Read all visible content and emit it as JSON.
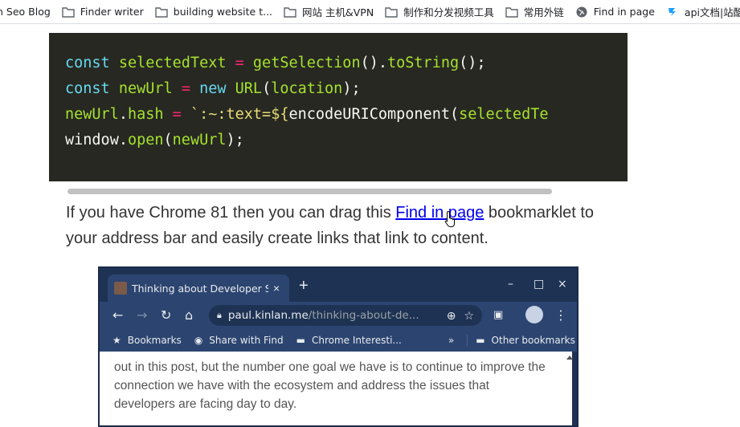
{
  "bookmarks_bar": {
    "items": [
      {
        "label": "n Seo Blog",
        "icon": "none"
      },
      {
        "label": "Finder writer",
        "icon": "folder-icon"
      },
      {
        "label": "building website t...",
        "icon": "folder-icon"
      },
      {
        "label": "网站 主机&VPN",
        "icon": "folder-icon"
      },
      {
        "label": "制作和分发视频工具",
        "icon": "folder-icon"
      },
      {
        "label": "常用外链",
        "icon": "folder-icon"
      },
      {
        "label": "Find in page",
        "icon": "globe-icon"
      },
      {
        "label": "api文档|站酷海洛",
        "icon": "brand-icon"
      }
    ]
  },
  "code_block": {
    "line1": {
      "kw": "const",
      "name": "selectedText",
      "op": "=",
      "fn": "getSelection",
      "p1": "().",
      "fn2": "toString",
      "p2": "();"
    },
    "line2": {
      "kw": "const",
      "name": "newUrl",
      "op": "=",
      "kw2": "new",
      "fn": "URL",
      "p1": "(",
      "arg": "location",
      "p2": ");"
    },
    "line3": {
      "obj": "newUrl",
      "dot": ".",
      "prop": "hash",
      "op": "=",
      "tpl": "`:~:text=${",
      "fn": "encodeURIComponent",
      "p1": "(",
      "arg": "selectedTe"
    },
    "line4": {
      "obj": "window",
      "dot": ".",
      "fn": "open",
      "p1": "(",
      "arg": "newUrl",
      "p2": ");"
    }
  },
  "paragraph": {
    "before": "If you have Chrome 81 then you can drag this ",
    "link": "Find in page",
    "after": " bookmarklet to your address bar and easily create links that link to content."
  },
  "embedded_screenshot": {
    "tab_title": "Thinking about Developer Sa",
    "tab_close": "×",
    "new_tab": "+",
    "window_controls": [
      "–",
      "□",
      "×"
    ],
    "url_domain": "paul.kinlan.me",
    "url_path": "/thinking-about-de...",
    "bookmarks": [
      {
        "label": "Bookmarks",
        "icon": "star-icon"
      },
      {
        "label": "Share with Find",
        "icon": "globe-icon"
      },
      {
        "label": "Chrome Interesti...",
        "icon": "folder-icon"
      },
      {
        "label": "»",
        "icon": "none"
      },
      {
        "label": "Other bookmarks",
        "icon": "folder-icon"
      }
    ],
    "content_text": "out in this post, but the number one goal we have is to continue to improve the connection we have with the ecosystem and address the issues that developers are facing day to day."
  },
  "colors": {
    "code_bg": "#272822",
    "keyword": "#66d9ef",
    "identifier": "#a6e22e",
    "operator": "#f92672",
    "string": "#e6db74",
    "link": "#0000ee",
    "browser_frame": "#1e3354"
  }
}
